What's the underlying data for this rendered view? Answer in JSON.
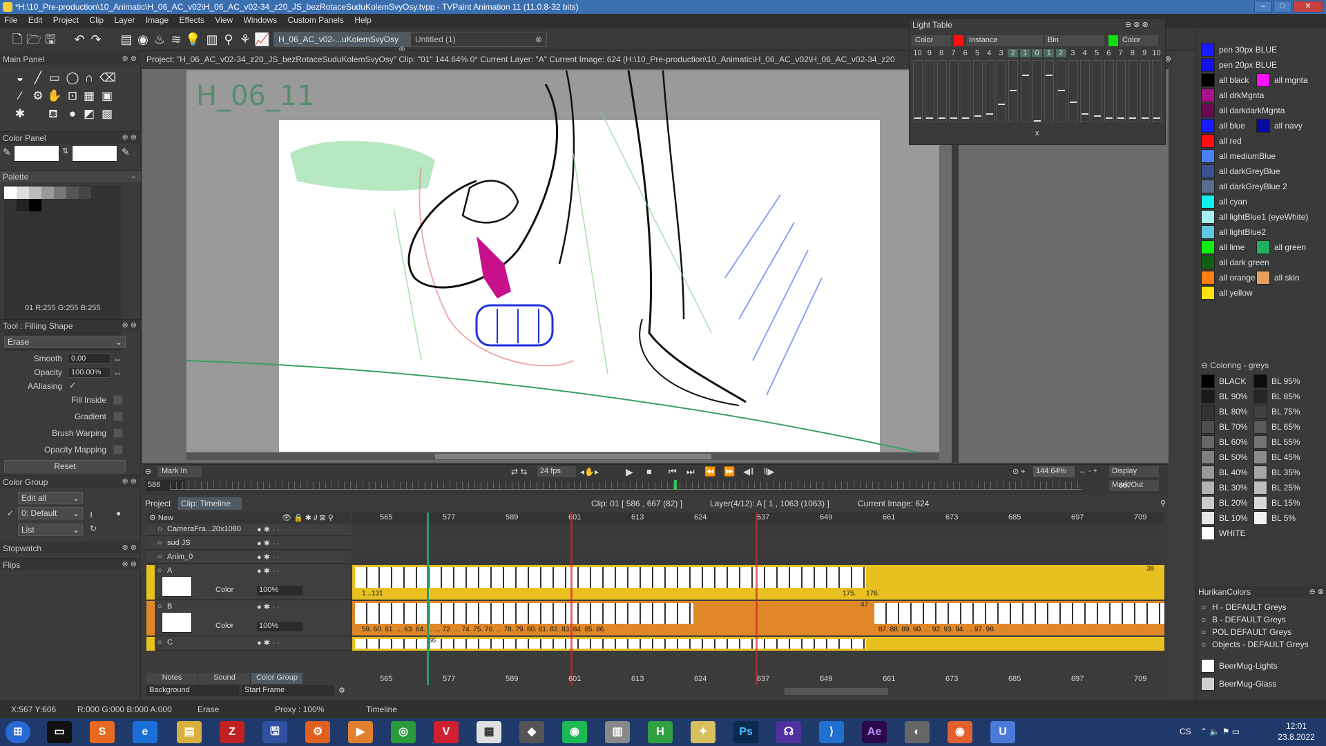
{
  "window": {
    "title": "*H:\\10_Pre-production\\10_Animatic\\H_06_AC_v02\\H_06_AC_v02-34_z20_JS_bezRotaceSuduKolemSvyOsy.tvpp - TVPaint Animation 11 (11.0.8-32 bits)"
  },
  "menu": [
    "File",
    "Edit",
    "Project",
    "Clip",
    "Layer",
    "Image",
    "Effects",
    "View",
    "Windows",
    "Custom Panels",
    "Help"
  ],
  "tabs": {
    "active": "H_06_AC_v02-...uKolemSvyOsy",
    "second": "Untitled (1)"
  },
  "main_panel": {
    "title": "Main Panel"
  },
  "color_panel": {
    "title": "Color Panel",
    "palette_label": "Palette",
    "rgb_readout": "01 R:255 G:255 B:255"
  },
  "tool_panel": {
    "title": "Tool : Filling Shape",
    "mode": "Erase",
    "smooth_label": "Smooth",
    "smooth_value": "0.00",
    "opacity_label": "Opacity",
    "opacity_value": "100.00%",
    "aaliasing_label": "AAliasing",
    "fill_inside_label": "Fill Inside",
    "gradient_label": "Gradient",
    "brush_warping_label": "Brush Warping",
    "opacity_mapping_label": "Opacity Mapping",
    "reset_label": "Reset"
  },
  "color_group": {
    "title": "Color Group",
    "edit_all": "Edit all",
    "default": "0: Default",
    "list": "List"
  },
  "stopwatch": "Stopwatch",
  "flips": "Flips",
  "project_info": "Project: \"H_06_AC_v02-34_z20_JS_bezRotaceSuduKolemSvyOsy\"  Clip: \"01\"  144.64%  0°  Current Layer: \"A\"  Current Image: 624 (H:\\10_Pre-production\\10_Animatic\\H_06_AC_v02\\H_06_AC_v02-34_z20",
  "canvas": {
    "scene_label": "H_06_11"
  },
  "light_table": {
    "title": "Light Table",
    "color_label": "Color",
    "instance_label": "Instance",
    "bin_label": "Bin",
    "color_label2": "Color",
    "numbers": [
      "10",
      "9",
      "8",
      "7",
      "6",
      "5",
      "4",
      "3",
      "2",
      "1",
      "0",
      "1",
      "2",
      "3",
      "4",
      "5",
      "6",
      "7",
      "8",
      "9",
      "10"
    ],
    "levels_percent": [
      5,
      5,
      5,
      5,
      5,
      8,
      12,
      28,
      52,
      78,
      0,
      78,
      52,
      32,
      12,
      8,
      5,
      5,
      5,
      5,
      5
    ]
  },
  "swatches": [
    {
      "c1": "#1a1aff",
      "t1": "pen 30px BLUE"
    },
    {
      "c1": "#1212e8",
      "t1": "pen 20px BLUE"
    },
    {
      "c1": "#000000",
      "t1": "all black",
      "c2": "#ff10ff",
      "t2": "all mgnta"
    },
    {
      "c1": "#a8108a",
      "t1": "all drkMgnta"
    },
    {
      "c1": "#6a0a50",
      "t1": "all darkdarkMgnta"
    },
    {
      "c1": "#1a1aff",
      "t1": "all blue",
      "c2": "#0a0aa0",
      "t2": "all navy"
    },
    {
      "c1": "#ff1010",
      "t1": "all red"
    },
    {
      "c1": "#4a80f0",
      "t1": "all mediumBlue"
    },
    {
      "c1": "#3a5090",
      "t1": "all darkGreyBlue"
    },
    {
      "c1": "#5a6c90",
      "t1": "all darkGreyBlue 2"
    },
    {
      "c1": "#10f0f0",
      "t1": "all cyan"
    },
    {
      "c1": "#a8f0f0",
      "t1": "all lightBlue1 (eyeWhite)"
    },
    {
      "c1": "#60c8e0",
      "t1": "all lightBlue2"
    },
    {
      "c1": "#10f010",
      "t1": "all lime",
      "c2": "#20b060",
      "t2": "all green"
    },
    {
      "c1": "#106010",
      "t1": "all dark green"
    },
    {
      "c1": "#ff8010",
      "t1": "all orange",
      "c2": "#e8a060",
      "t2": "all skin"
    },
    {
      "c1": "#ffe010",
      "t1": "all yellow"
    }
  ],
  "coloring_greys": {
    "title": "Coloring - greys",
    "items": [
      {
        "c1": "#000000",
        "t1": "BLACK",
        "c2": "#0d0d0d",
        "t2": "BL 95%"
      },
      {
        "c1": "#1a1a1a",
        "t1": "BL 90%",
        "c2": "#262626",
        "t2": "BL 85%"
      },
      {
        "c1": "#333333",
        "t1": "BL 80%",
        "c2": "#404040",
        "t2": "BL 75%"
      },
      {
        "c1": "#4d4d4d",
        "t1": "BL 70%",
        "c2": "#595959",
        "t2": "BL 65%"
      },
      {
        "c1": "#666666",
        "t1": "BL 60%",
        "c2": "#737373",
        "t2": "BL 55%"
      },
      {
        "c1": "#808080",
        "t1": "BL 50%",
        "c2": "#8c8c8c",
        "t2": "BL 45%"
      },
      {
        "c1": "#999999",
        "t1": "BL 40%",
        "c2": "#a6a6a6",
        "t2": "BL 35%"
      },
      {
        "c1": "#b3b3b3",
        "t1": "BL 30%",
        "c2": "#bfbfbf",
        "t2": "BL 25%"
      },
      {
        "c1": "#cccccc",
        "t1": "BL 20%",
        "c2": "#d9d9d9",
        "t2": "BL 15%"
      },
      {
        "c1": "#e6e6e6",
        "t1": "BL 10%",
        "c2": "#f2f2f2",
        "t2": "BL 5%"
      },
      {
        "c1": "#ffffff",
        "t1": "WHITE"
      }
    ]
  },
  "hurikan": {
    "title": "HurikanColors",
    "groups": [
      "H - DEFAULT Greys",
      "B - DEFAULT Greys",
      "POL DEFAULT Greys",
      "Objects - DEFAULT Greys"
    ],
    "items": [
      {
        "c1": "#ffffff",
        "t1": "BeerMug-Lights"
      },
      {
        "c1": "#d0d0d0",
        "t1": "BeerMug-Glass"
      }
    ]
  },
  "transport": {
    "mark_in": "Mark In",
    "mark_in_value": "586",
    "fps": "24 fps",
    "zoom": "144.64%",
    "display": "Display",
    "mark_out": "Mark Out",
    "mark_out_value": "667"
  },
  "timeline": {
    "project_tab": "Project",
    "clip_tab": "Clip: Timeline",
    "clip_info": "Clip: 01 [ 586 , 667  (82) ]",
    "layer_info": "Layer(4/12): A [ 1 , 1063  (1063) ]",
    "current_image": "Current Image: 624",
    "new_label": "New",
    "ruler": [
      "565",
      "577",
      "589",
      "601",
      "613",
      "624",
      "637",
      "649",
      "661",
      "673",
      "685",
      "697",
      "709"
    ],
    "layers": [
      {
        "name": "CameraFra...20x1080"
      },
      {
        "name": "sud JS"
      },
      {
        "name": "Anim_0"
      },
      {
        "name": "A",
        "mode": "Color",
        "opacity": "100%",
        "end_num": "38",
        "marker_a": "1...131",
        "marker_b": "175.",
        "marker_c": "176."
      },
      {
        "name": "B",
        "mode": "Color",
        "opacity": "100%",
        "end_num": "47",
        "marker_a": "59.  60.  61. ... 63.  64. ....... 72. ... 74.  75.  76. ... 78.  79.  80.  81.  82.  83.  84.  85.  86.",
        "marker_b": "87.  88.  89.  90. ... 92.  93.  94. ... 97.  98."
      },
      {
        "name": "C",
        "end_num": "66"
      }
    ],
    "bottom_tabs": [
      "Notes",
      "Sound",
      "Color Group"
    ],
    "background": "Background",
    "start_frame": "Start Frame"
  },
  "status": {
    "coords": "X:567  Y:606",
    "rgba": "R:000 G:000 B:000 A:000",
    "tool": "Erase",
    "proxy": "Proxy : 100%",
    "panel": "Timeline"
  },
  "tray": {
    "lang": "CS",
    "time": "12:01",
    "date": "23.8.2022"
  }
}
